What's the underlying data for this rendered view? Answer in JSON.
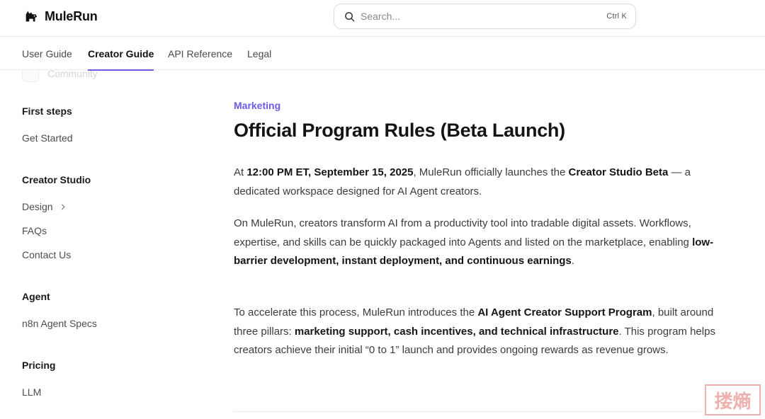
{
  "header": {
    "brand": "MuleRun",
    "search": {
      "placeholder": "Search...",
      "shortcut": "Ctrl K"
    }
  },
  "tabs": [
    {
      "label": "User Guide",
      "active": false
    },
    {
      "label": "Creator Guide",
      "active": true
    },
    {
      "label": "API Reference",
      "active": false
    },
    {
      "label": "Legal",
      "active": false
    }
  ],
  "sidebar": {
    "cut_item": "Community",
    "sections": [
      {
        "heading": "First steps",
        "items": [
          "Get Started"
        ]
      },
      {
        "heading": "Creator Studio",
        "items": [
          "Design",
          "FAQs",
          "Contact Us"
        ]
      },
      {
        "heading": "Agent",
        "items": [
          "n8n Agent Specs"
        ]
      },
      {
        "heading": "Pricing",
        "items": [
          "LLM"
        ]
      }
    ]
  },
  "article": {
    "eyebrow": "Marketing",
    "title": "Official Program Rules (Beta Launch)",
    "p1": {
      "a": "At ",
      "b1": "12:00 PM ET, September 15, 2025",
      "c": ", MuleRun officially launches the ",
      "b2": "Creator Studio Beta",
      "d": " — a dedicated workspace designed for AI Agent creators."
    },
    "p2": {
      "a": "On MuleRun, creators transform AI from a productivity tool into tradable digital assets. Workflows, expertise, and skills can be quickly packaged into Agents and listed on the marketplace, enabling ",
      "b1": "low-barrier development, instant deployment, and continuous earnings",
      "c": "."
    },
    "p3": {
      "a": "To accelerate this process, MuleRun introduces the ",
      "b1": "AI Agent Creator Support Program",
      "c": ", built around three pillars: ",
      "b2": "marketing support, cash incentives, and technical infrastructure",
      "d": ". This program helps creators achieve their initial “0 to 1” launch and provides ongoing rewards as revenue grows."
    }
  },
  "watermark": "搂熵",
  "colors": {
    "accent": "#6b5ce7",
    "stamp": "#d9534f"
  }
}
